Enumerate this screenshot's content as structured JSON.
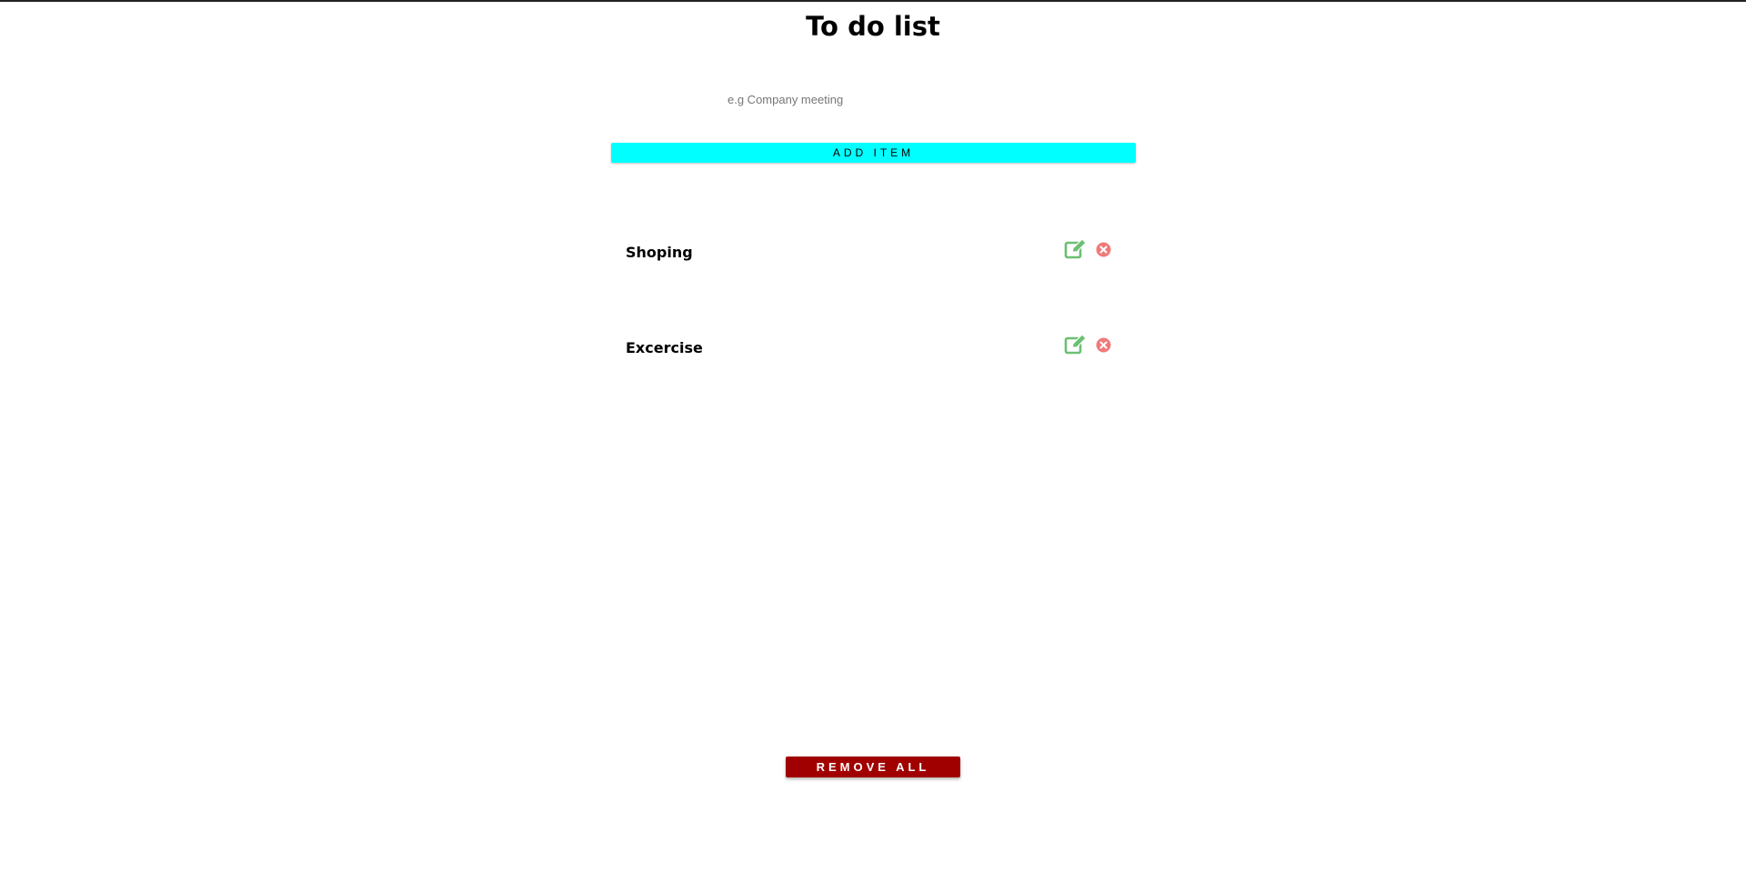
{
  "header": {
    "title": "To do list"
  },
  "form": {
    "input_placeholder": "e.g Company meeting",
    "input_value": "",
    "add_button_label": "ADD ITEM"
  },
  "todos": [
    {
      "label": "Shoping",
      "edit_icon": "edit-icon",
      "delete_icon": "close-circle-icon"
    },
    {
      "label": "Excercise",
      "edit_icon": "edit-icon",
      "delete_icon": "close-circle-icon"
    }
  ],
  "footer": {
    "remove_all_label": "REMOVE ALL"
  },
  "colors": {
    "add_button": "#00ffff",
    "remove_all_button": "#a10000",
    "edit_icon": "#6cbf73",
    "delete_icon": "#f07a7a"
  }
}
